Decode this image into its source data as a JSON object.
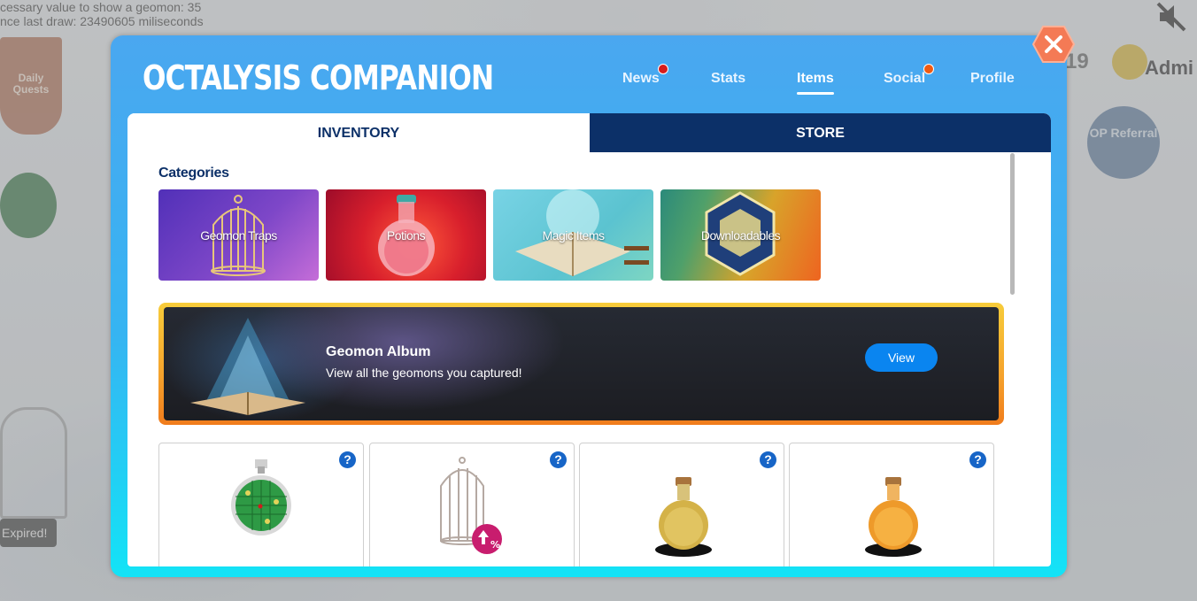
{
  "background": {
    "debug_text": "cessary value to show a geomon: 35\nnce last draw: 23490605 miliseconds",
    "daily_quests_label": "Daily Quests",
    "expired_label": "Expired!",
    "user_label": "Admi",
    "partial_count": "19",
    "referral_label": "OP Referral"
  },
  "modal": {
    "title": "OCTALYSIS COMPANION",
    "nav": [
      {
        "label": "News",
        "notification": true,
        "dot_color": "#d61c1c"
      },
      {
        "label": "Stats",
        "notification": false
      },
      {
        "label": "Items",
        "active": true
      },
      {
        "label": "Social",
        "notification": true,
        "dot_color": "#f05a12"
      },
      {
        "label": "Profile",
        "notification": false
      }
    ],
    "close_icon": "close-hexagon-icon"
  },
  "tabs": {
    "inventory": "INVENTORY",
    "store": "STORE",
    "active": "INVENTORY"
  },
  "categories": {
    "label": "Categories",
    "items": [
      {
        "name": "Geomon Traps",
        "icon": "birdcage-icon"
      },
      {
        "name": "Potions",
        "icon": "potion-flask-icon"
      },
      {
        "name": "Magic Items",
        "icon": "magic-book-icon"
      },
      {
        "name": "Downloadables",
        "icon": "hexagon-emblem-icon"
      }
    ]
  },
  "album": {
    "title": "Geomon Album",
    "description": "View all the geomons you captured!",
    "button": "View",
    "icon": "glowing-book-icon"
  },
  "items": [
    {
      "icon": "geomon-radar-icon",
      "help": "?"
    },
    {
      "icon": "cage-upgrade-icon",
      "help": "?",
      "badge": "%"
    },
    {
      "icon": "golden-potion-icon",
      "help": "?"
    },
    {
      "icon": "orange-potion-icon",
      "help": "?"
    }
  ],
  "colors": {
    "accent": "#0c3068",
    "modal_top": "#4aa7f0",
    "modal_bottom": "#13e3f6",
    "close": "#f47a55",
    "view_button": "#0a85f0"
  }
}
